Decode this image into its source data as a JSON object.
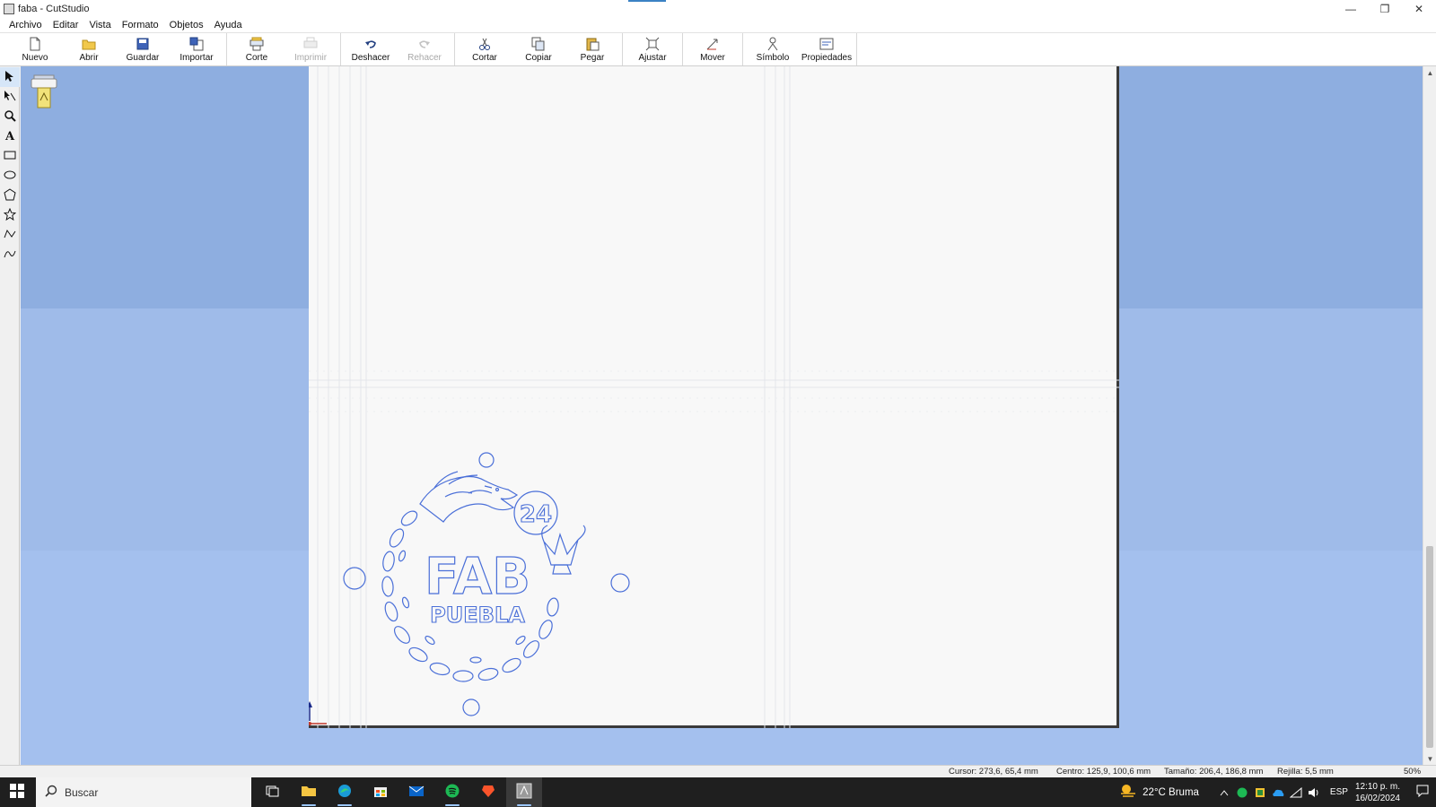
{
  "window": {
    "title": "faba - CutStudio",
    "controls": {
      "minimize": "—",
      "restore": "❐",
      "close": "✕"
    }
  },
  "menu": [
    "Archivo",
    "Editar",
    "Vista",
    "Formato",
    "Objetos",
    "Ayuda"
  ],
  "toolbar": {
    "groups": [
      [
        {
          "label": "Nuevo",
          "icon": "new-file-icon"
        },
        {
          "label": "Abrir",
          "icon": "open-folder-icon"
        },
        {
          "label": "Guardar",
          "icon": "save-disk-icon"
        },
        {
          "label": "Importar",
          "icon": "import-icon"
        }
      ],
      [
        {
          "label": "Corte",
          "icon": "cut-plotter-icon"
        },
        {
          "label": "Imprimir",
          "icon": "print-icon",
          "disabled": true
        }
      ],
      [
        {
          "label": "Deshacer",
          "icon": "undo-icon"
        },
        {
          "label": "Rehacer",
          "icon": "redo-icon",
          "disabled": true
        }
      ],
      [
        {
          "label": "Cortar",
          "icon": "scissors-icon"
        },
        {
          "label": "Copiar",
          "icon": "copy-icon"
        },
        {
          "label": "Pegar",
          "icon": "paste-icon"
        }
      ],
      [
        {
          "label": "Ajustar",
          "icon": "fit-icon"
        }
      ],
      [
        {
          "label": "Mover",
          "icon": "move-icon"
        }
      ],
      [
        {
          "label": "Símbolo",
          "icon": "symbol-icon"
        },
        {
          "label": "Propiedades",
          "icon": "properties-icon"
        }
      ]
    ]
  },
  "tools": [
    "select-arrow-icon",
    "edit-points-icon",
    "zoom-icon",
    "text-icon",
    "rectangle-icon",
    "ellipse-icon",
    "polygon-icon",
    "star-icon",
    "polyline-icon",
    "curve-icon"
  ],
  "design": {
    "logo_text": "FAB",
    "logo_subtext": "PUEBLA",
    "badge_text": "24",
    "stroke_color": "#4a6fd8"
  },
  "status": {
    "cursor": "Cursor: 273,6, 65,4 mm",
    "center": "Centro: 125,9, 100,6 mm",
    "size": "Tamaño: 206,4, 186,8 mm",
    "grid": "Rejilla: 5,5 mm",
    "zoom": "50%"
  },
  "taskbar": {
    "search_placeholder": "Buscar",
    "apps": [
      "task-view-icon",
      "file-explorer-icon",
      "edge-icon",
      "store-icon",
      "mail-icon",
      "spotify-icon",
      "brave-icon",
      "cutstudio-icon"
    ],
    "weather": "22°C  Bruma",
    "language": "ESP",
    "time": "12:10 p. m.",
    "date": "16/02/2024"
  },
  "colors": {
    "workspace": "#9fbbe9",
    "page": "#f8f8f8",
    "accent": "#3b82c4",
    "taskbar": "#1f1f1f"
  }
}
